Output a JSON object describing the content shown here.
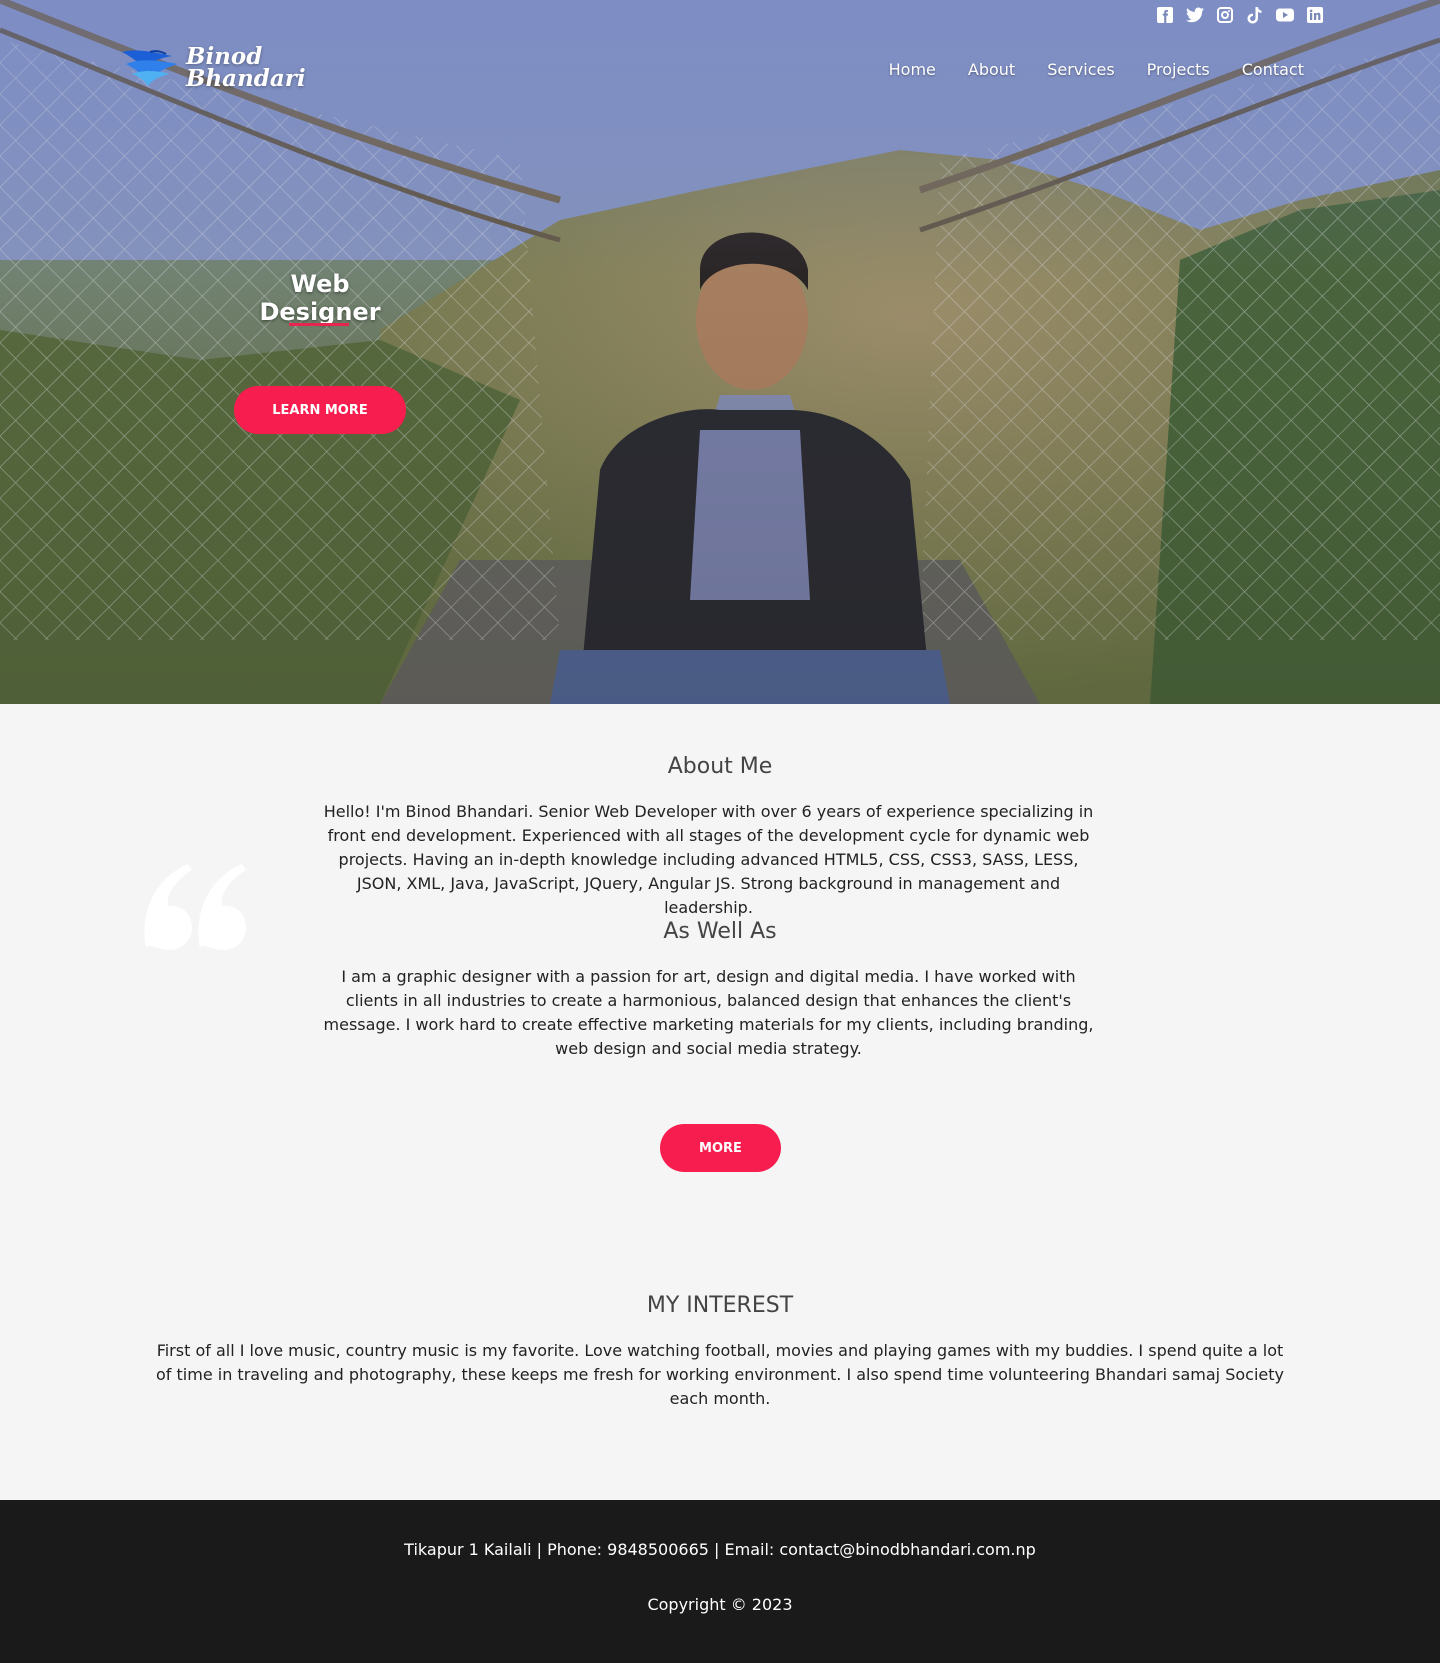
{
  "social": {
    "icons": [
      "facebook-icon",
      "twitter-icon",
      "instagram-icon",
      "tiktok-icon",
      "youtube-icon",
      "linkedin-icon"
    ]
  },
  "logo": {
    "line1": "Binod",
    "line2": "Bhandari"
  },
  "nav": {
    "items": [
      "Home",
      "About",
      "Services",
      "Projects",
      "Contact"
    ]
  },
  "hero": {
    "title": "Web Designer",
    "button": "LEARN MORE"
  },
  "about": {
    "title": "About Me",
    "paragraph1": "Hello! I'm Binod Bhandari. Senior Web Developer with over 6 years of experience specializing in front end development. Experienced with all stages of the development cycle for dynamic web projects. Having an in-depth knowledge including advanced HTML5, CSS, CSS3, SASS, LESS, JSON, XML, Java, JavaScript, JQuery, Angular JS. Strong background in management and leadership.",
    "subtitle": "As Well As",
    "paragraph2": "I am a graphic designer with a passion for art, design and digital media. I have worked with clients in all industries to create a harmonious, balanced design that enhances the client's message. I work hard to create effective marketing materials for my clients, including branding, web design and social media strategy.",
    "button": "MORE"
  },
  "interest": {
    "title": "MY INTEREST",
    "paragraph": "First of all I love music, country music is my favorite. Love watching football, movies and playing games with my buddies. I spend quite a lot of time in traveling and photography, these keeps me fresh for working environment. I also spend time volunteering Bhandari samaj Society each month."
  },
  "footer": {
    "address": "Tikapur 1 Kailali",
    "phone": "Phone: 9848500665",
    "email": "Email: contact@binodbhandari.com.np",
    "copyright": "Copyright © 2023"
  },
  "colors": {
    "accent": "#f71e4f",
    "footer_bg": "#1a1a1a",
    "page_bg": "#f5f5f5"
  }
}
